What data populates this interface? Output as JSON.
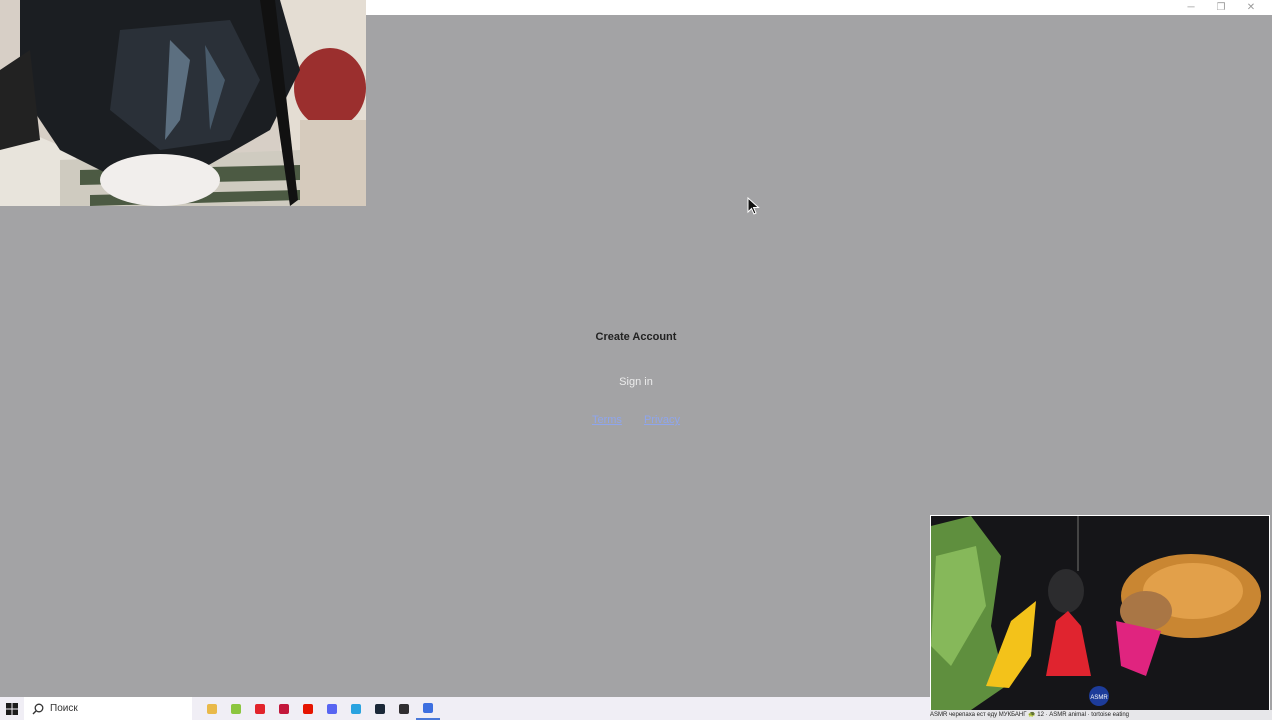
{
  "window": {
    "controls": {
      "minimize": "─",
      "restore": "❐",
      "close": "✕"
    }
  },
  "auth": {
    "create_account": "Create Account",
    "sign_in": "Sign in",
    "terms": "Terms",
    "privacy": "Privacy"
  },
  "overlay_video": {
    "caption": "ASMR черепаха ест еду МУКБАНГ 🐢 12 · ASMR animal · tortoise eating",
    "badge": "ASMR"
  },
  "taskbar": {
    "search_placeholder": "Поиск",
    "apps": [
      {
        "name": "file-explorer-icon",
        "color": "#e9b949"
      },
      {
        "name": "app-green-icon",
        "color": "#8cc63f"
      },
      {
        "name": "opera-icon",
        "color": "#e2242b"
      },
      {
        "name": "app-red-icon",
        "color": "#c3173b"
      },
      {
        "name": "yandex-icon",
        "color": "#e61400"
      },
      {
        "name": "discord-icon",
        "color": "#5865f2"
      },
      {
        "name": "telegram-icon",
        "color": "#2aa3e0"
      },
      {
        "name": "steam-icon",
        "color": "#1b2838"
      },
      {
        "name": "obs-icon",
        "color": "#302e31"
      },
      {
        "name": "active-app-icon",
        "color": "#3d6fe0"
      }
    ]
  },
  "colors": {
    "background": "#a3a3a5",
    "link": "#8aa6ff"
  }
}
